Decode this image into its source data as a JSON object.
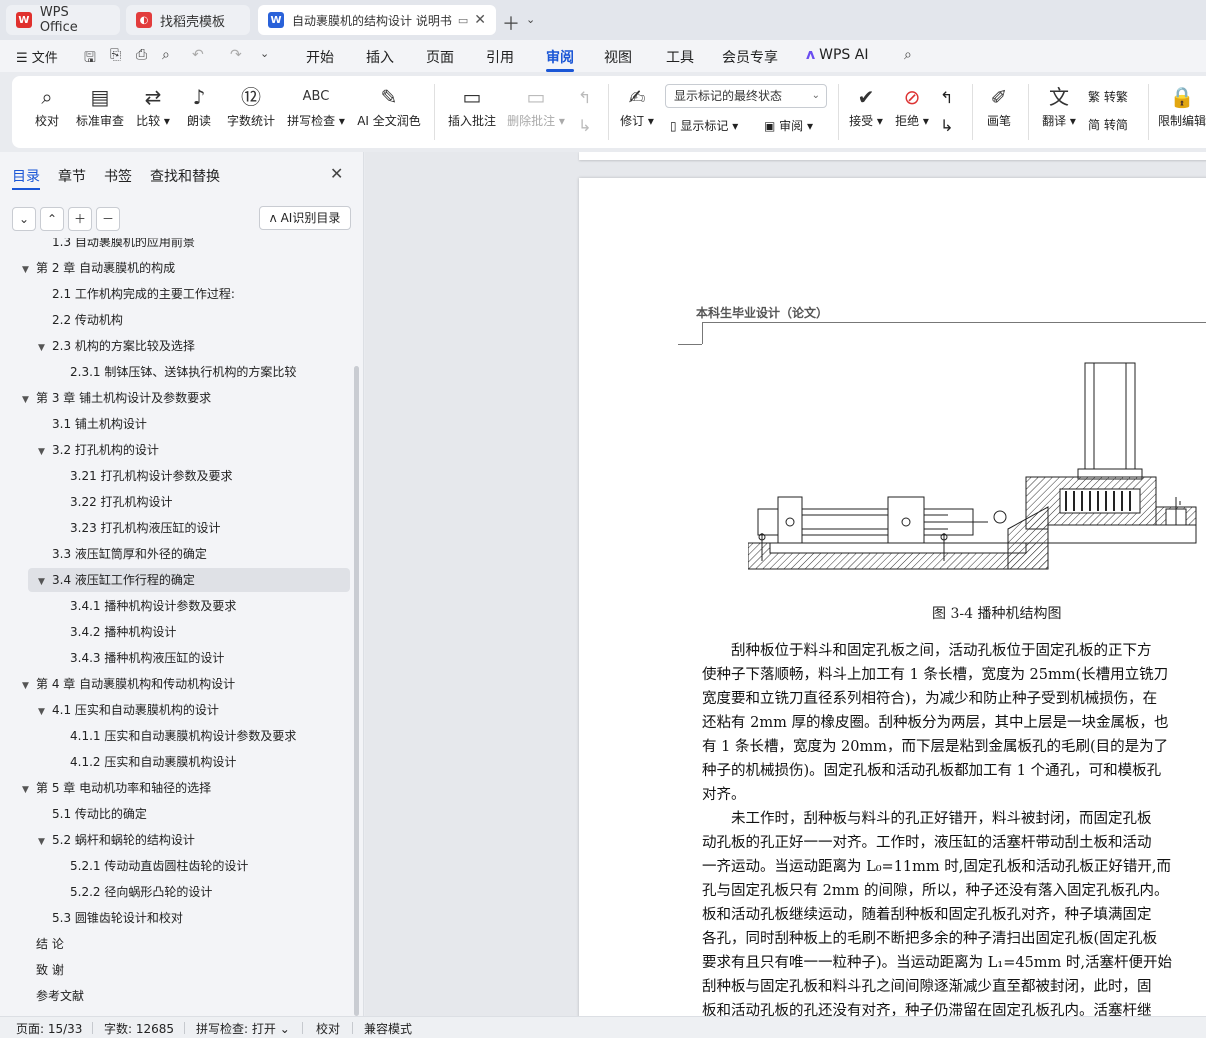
{
  "tabs": [
    {
      "label": "WPS Office",
      "icon": "wps-logo-icon",
      "color": "#e0312e"
    },
    {
      "label": "找稻壳模板",
      "icon": "docer-logo-icon",
      "color": "#e23c3c"
    },
    {
      "label": "自动裹膜机的结构设计 说明书",
      "icon": "word-doc-icon",
      "color": "#2a62d9"
    }
  ],
  "menubar": {
    "file": "文件",
    "items": [
      "开始",
      "插入",
      "页面",
      "引用",
      "审阅",
      "视图",
      "工具",
      "会员专享"
    ],
    "active": "审阅",
    "wpsai": "WPS AI"
  },
  "ribbon": {
    "buttons": [
      {
        "label": "校对",
        "icon": "proofread-icon"
      },
      {
        "label": "标准审查",
        "icon": "standard-review-icon"
      },
      {
        "label": "比较",
        "icon": "compare-icon"
      },
      {
        "label": "朗读",
        "icon": "read-aloud-icon"
      },
      {
        "label": "字数统计",
        "icon": "word-count-icon"
      },
      {
        "label": "拼写检查",
        "icon": "spell-check-icon"
      },
      {
        "label": "AI 全文润色",
        "icon": "ai-polish-icon"
      },
      {
        "label": "插入批注",
        "icon": "insert-comment-icon"
      },
      {
        "label": "删除批注",
        "icon": "delete-comment-icon"
      },
      {
        "label": "修订",
        "icon": "revise-icon"
      },
      {
        "label": "接受",
        "icon": "accept-icon"
      },
      {
        "label": "拒绝",
        "icon": "reject-icon"
      },
      {
        "label": "画笔",
        "icon": "pen-icon"
      },
      {
        "label": "翻译",
        "icon": "translate-icon"
      },
      {
        "label": "限制编辑",
        "icon": "restrict-edit-icon"
      }
    ],
    "markup_select": "显示标记的最终状态",
    "show_markup": "显示标记",
    "review": "审阅",
    "to_traditional": "转繁",
    "to_simplified": "转简"
  },
  "sidebar": {
    "tabs": [
      "目录",
      "章节",
      "书签",
      "查找和替换"
    ],
    "ai_toc": "AI识别目录",
    "toc": [
      {
        "label": "1.3  自动裹膜机的应用前景",
        "level": 2,
        "tri": ""
      },
      {
        "label": "第 2 章  自动裹膜机的构成",
        "level": 1,
        "tri": "▼"
      },
      {
        "label": "2.1  工作机构完成的主要工作过程:",
        "level": 2,
        "tri": ""
      },
      {
        "label": "2.2  传动机构",
        "level": 2,
        "tri": ""
      },
      {
        "label": "2.3  机构的方案比较及选择",
        "level": 2,
        "tri": "▼"
      },
      {
        "label": "2.3.1  制钵压钵、送钵执行机构的方案比较",
        "level": 3,
        "tri": ""
      },
      {
        "label": "第 3 章  铺土机构设计及参数要求",
        "level": 1,
        "tri": "▼"
      },
      {
        "label": "3.1  铺土机构设计",
        "level": 2,
        "tri": ""
      },
      {
        "label": "3.2  打孔机构的设计",
        "level": 2,
        "tri": "▼"
      },
      {
        "label": "3.21  打孔机构设计参数及要求",
        "level": 3,
        "tri": ""
      },
      {
        "label": "3.22  打孔机构设计",
        "level": 3,
        "tri": ""
      },
      {
        "label": "3.23  打孔机构液压缸的设计",
        "level": 3,
        "tri": ""
      },
      {
        "label": "3.3  液压缸筒厚和外径的确定",
        "level": 2,
        "tri": ""
      },
      {
        "label": "3.4  液压缸工作行程的确定",
        "level": 2,
        "tri": "▼"
      },
      {
        "label": "3.4.1  播种机构设计参数及要求",
        "level": 3,
        "tri": ""
      },
      {
        "label": "3.4.2  播种机构设计",
        "level": 3,
        "tri": ""
      },
      {
        "label": "3.4.3  播种机构液压缸的设计",
        "level": 3,
        "tri": ""
      },
      {
        "label": "第 4 章  自动裹膜机构和传动机构设计",
        "level": 1,
        "tri": "▼"
      },
      {
        "label": "4.1  压实和自动裹膜机构的设计",
        "level": 2,
        "tri": "▼"
      },
      {
        "label": "4.1.1  压实和自动裹膜机构设计参数及要求",
        "level": 3,
        "tri": ""
      },
      {
        "label": "4.1.2  压实和自动裹膜机构设计",
        "level": 3,
        "tri": ""
      },
      {
        "label": "第 5 章  电动机功率和轴径的选择",
        "level": 1,
        "tri": "▼"
      },
      {
        "label": "5.1  传动比的确定",
        "level": 2,
        "tri": ""
      },
      {
        "label": "5.2  蜗杆和蜗轮的结构设计",
        "level": 2,
        "tri": "▼"
      },
      {
        "label": "5.2.1  传动动直齿圆柱齿轮的设计",
        "level": 3,
        "tri": ""
      },
      {
        "label": "5.2.2  径向蜗形凸轮的设计",
        "level": 3,
        "tri": ""
      },
      {
        "label": "5.3 圆锥齿轮设计和校对",
        "level": 2,
        "tri": ""
      },
      {
        "label": "结  论",
        "level": 1,
        "tri": ""
      },
      {
        "label": "致  谢",
        "level": 1,
        "tri": ""
      },
      {
        "label": "参考文献",
        "level": 1,
        "tri": ""
      }
    ],
    "selected": "3.4  液压缸工作行程的确定"
  },
  "document": {
    "header": "本科生毕业设计（论文）",
    "caption": "图 3-4  播种机结构图",
    "para1": [
      "　　刮种板位于料斗和固定孔板之间，活动孔板位于固定孔板的正下方",
      "使种子下落顺畅，料斗上加工有 1 条长槽，宽度为 25mm(长槽用立铣刀",
      "宽度要和立铣刀直径系列相符合)，为减少和防止种子受到机械损伤，在",
      "还粘有 2mm 厚的橡皮圈。刮种板分为两层，其中上层是一块金属板，也",
      "有 1 条长槽，宽度为 20mm，而下层是粘到金属板孔的毛刷(目的是为了",
      "种子的机械损伤)。固定孔板和活动孔板都加工有 1 个通孔，可和模板孔",
      "对齐。"
    ],
    "para2": [
      "　　未工作时，刮种板与料斗的孔正好错开，料斗被封闭，而固定孔板",
      "动孔板的孔正好一一对齐。工作时，液压缸的活塞杆带动刮土板和活动",
      "一齐运动。当运动距离为 L₀=11mm 时,固定孔板和活动孔板正好错开,而",
      "孔与固定孔板只有 2mm 的间隙，所以，种子还没有落入固定孔板孔内。",
      "板和活动孔板继续运动，随着刮种板和固定孔板孔对齐，种子填满固定",
      "各孔，同时刮种板上的毛刷不断把多余的种子清扫出固定孔板(固定孔板",
      "要求有且只有唯一一粒种子)。当运动距离为 L₁=45mm 时,活塞杆便开始",
      "刮种板与固定孔板和料斗孔之间间隙逐渐减少直至都被封闭，此时，固",
      "板和活动孔板的孔还没有对齐，种子仍滞留在固定孔板孔内。活塞杆继"
    ]
  },
  "statusbar": {
    "page": "页面: 15/33",
    "words": "字数: 12685",
    "spell": "拼写检查: 打开",
    "proof": "校对",
    "compat": "兼容模式"
  }
}
